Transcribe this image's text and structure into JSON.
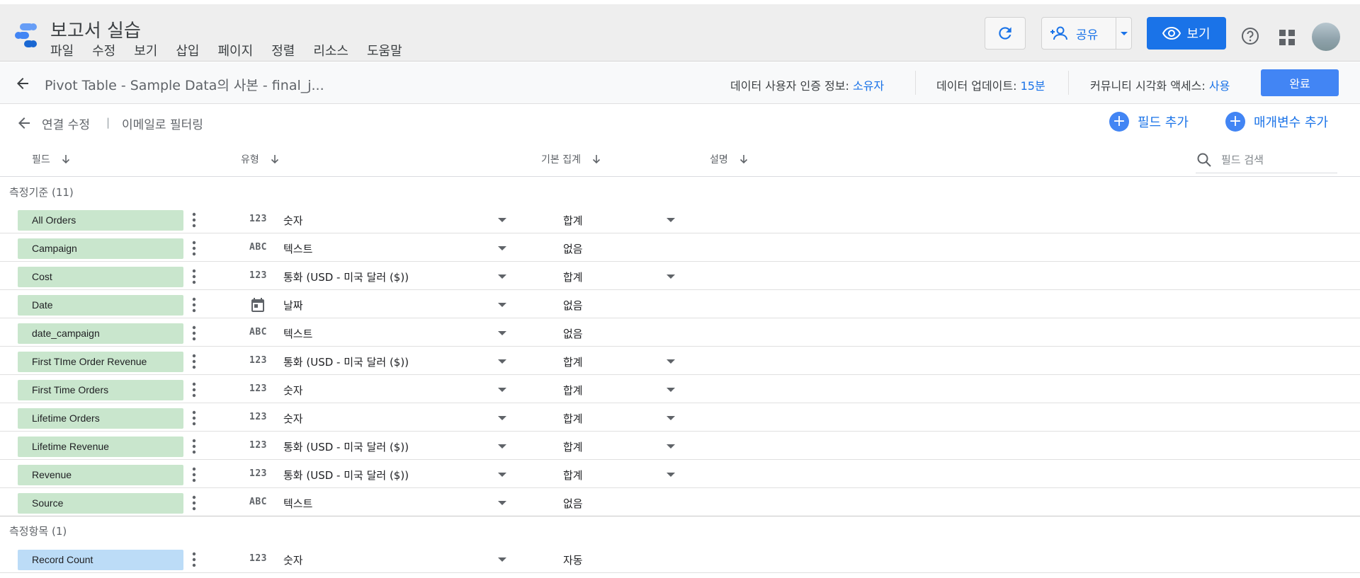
{
  "app": {
    "title": "보고서 실습",
    "menu": [
      "파일",
      "수정",
      "보기",
      "삽입",
      "페이지",
      "정렬",
      "리소스",
      "도움말"
    ],
    "share_label": "공유",
    "view_label": "보기"
  },
  "datasource": {
    "name": "Pivot Table - Sample Data의 사본 - final_j...",
    "credentials_label": "데이터 사용자 인증 정보:",
    "credentials_value": "소유자",
    "freshness_label": "데이터 업데이트:",
    "freshness_value": "15분",
    "community_label": "커뮤니티 시각화 액세스:",
    "community_value": "사용",
    "done_label": "완료"
  },
  "subbar": {
    "edit_connection": "연결 수정",
    "filter_by_email": "이메일로 필터링",
    "add_field": "필드 추가",
    "add_parameter": "매개변수 추가"
  },
  "columns": {
    "field": "필드",
    "type": "유형",
    "aggregation": "기본 집계",
    "description": "설명",
    "search_placeholder": "필드 검색"
  },
  "sections": [
    {
      "title": "측정기준 (11)",
      "rows": [
        {
          "name": "All Orders",
          "type_icon": "123",
          "type": "숫자",
          "agg": "합계",
          "agg_dropdown": true
        },
        {
          "name": "Campaign",
          "type_icon": "ABC",
          "type": "텍스트",
          "agg": "없음",
          "agg_dropdown": false
        },
        {
          "name": "Cost",
          "type_icon": "123",
          "type": "통화 (USD - 미국 달러 ($))",
          "agg": "합계",
          "agg_dropdown": true
        },
        {
          "name": "Date",
          "type_icon": "calendar",
          "type": "날짜",
          "agg": "없음",
          "agg_dropdown": false
        },
        {
          "name": "date_campaign",
          "type_icon": "ABC",
          "type": "텍스트",
          "agg": "없음",
          "agg_dropdown": false
        },
        {
          "name": "First TIme Order Revenue",
          "type_icon": "123",
          "type": "통화 (USD - 미국 달러 ($))",
          "agg": "합계",
          "agg_dropdown": true
        },
        {
          "name": "First Time Orders",
          "type_icon": "123",
          "type": "숫자",
          "agg": "합계",
          "agg_dropdown": true
        },
        {
          "name": "Lifetime Orders",
          "type_icon": "123",
          "type": "숫자",
          "agg": "합계",
          "agg_dropdown": true
        },
        {
          "name": "Lifetime Revenue",
          "type_icon": "123",
          "type": "통화 (USD - 미국 달러 ($))",
          "agg": "합계",
          "agg_dropdown": true
        },
        {
          "name": "Revenue",
          "type_icon": "123",
          "type": "통화 (USD - 미국 달러 ($))",
          "agg": "합계",
          "agg_dropdown": true
        },
        {
          "name": "Source",
          "type_icon": "ABC",
          "type": "텍스트",
          "agg": "없음",
          "agg_dropdown": false
        }
      ]
    },
    {
      "title": "측정항목 (1)",
      "rows": [
        {
          "name": "Record Count",
          "type_icon": "123",
          "type": "숫자",
          "agg": "자동",
          "agg_dropdown": false
        }
      ]
    }
  ],
  "colors": {
    "accent": "#1a73e8",
    "dimension_chip": "#c9e6cd",
    "metric_chip": "#bcdcf7"
  }
}
